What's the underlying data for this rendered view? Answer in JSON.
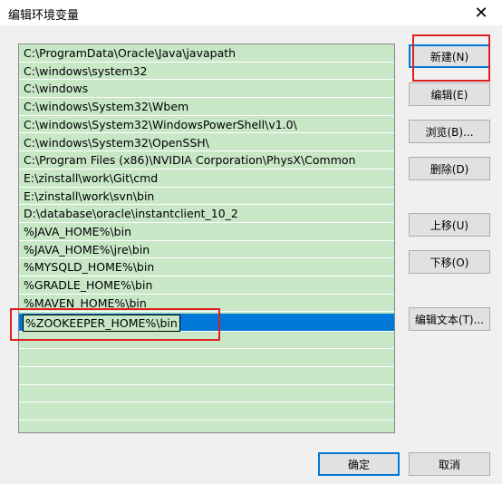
{
  "window": {
    "title": "编辑环境变量",
    "close_glyph": "✕"
  },
  "path_list": {
    "items": [
      "C:\\ProgramData\\Oracle\\Java\\javapath",
      "C:\\windows\\system32",
      "C:\\windows",
      "C:\\windows\\System32\\Wbem",
      "C:\\windows\\System32\\WindowsPowerShell\\v1.0\\",
      "C:\\windows\\System32\\OpenSSH\\",
      "C:\\Program Files (x86)\\NVIDIA Corporation\\PhysX\\Common",
      "E:\\zinstall\\work\\Git\\cmd",
      "E:\\zinstall\\work\\svn\\bin",
      "D:\\database\\oracle\\instantclient_10_2",
      "%JAVA_HOME%\\bin",
      "%JAVA_HOME%\\jre\\bin",
      "%MYSQLD_HOME%\\bin",
      "%GRADLE_HOME%\\bin",
      "%MAVEN_HOME%\\bin"
    ],
    "editing_value": "%ZOOKEEPER_HOME%\\bin"
  },
  "buttons": {
    "new": "新建(N)",
    "edit": "编辑(E)",
    "browse": "浏览(B)...",
    "delete": "删除(D)",
    "move_up": "上移(U)",
    "move_down": "下移(O)",
    "edit_text": "编辑文本(T)...",
    "ok": "确定",
    "cancel": "取消"
  },
  "colors": {
    "list_background": "#c7e7c7",
    "selection": "#0078d7",
    "highlight_annotation": "#e02020"
  }
}
